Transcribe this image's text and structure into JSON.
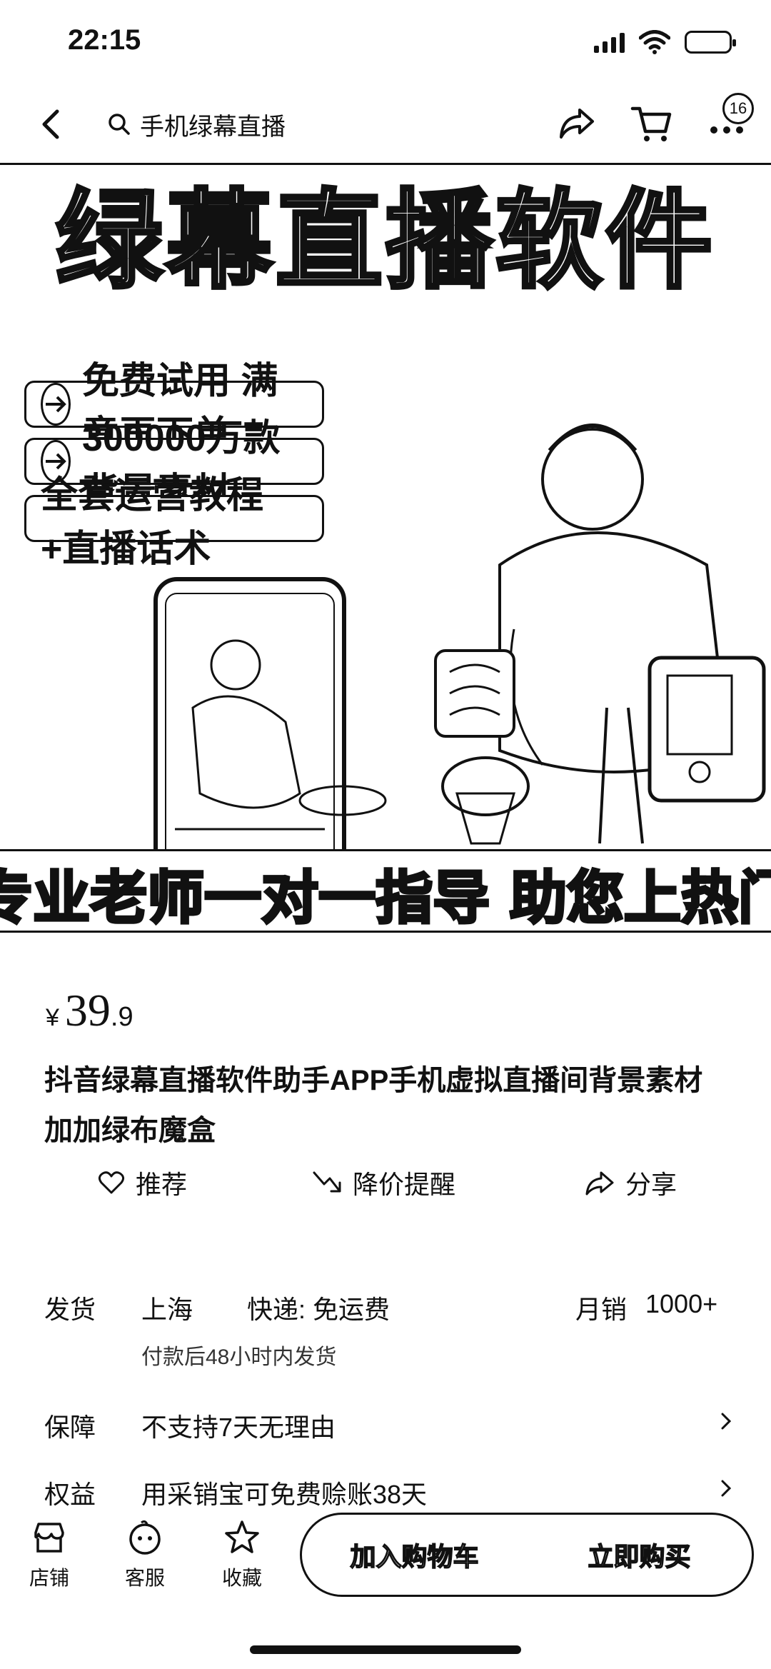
{
  "status_bar": {
    "time": "22:15"
  },
  "nav": {
    "search_text": "手机绿幕直播",
    "more_badge": "16"
  },
  "hero": {
    "title": "绿幕直播软件",
    "pills": [
      "免费试用 满意再下单",
      "300000万款背景素材",
      "全套运营教程+直播话术"
    ],
    "bottom_text": "专业老师一对一指导 助您上热门"
  },
  "product": {
    "currency": "¥",
    "price_int": "39",
    "price_dec": ".9",
    "title": "抖音绿幕直播软件助手APP手机虚拟直播间背景素材加加绿布魔盒"
  },
  "actions": {
    "recommend": "推荐",
    "price_alert": "降价提醒",
    "share": "分享"
  },
  "details": {
    "shipping_label": "发货",
    "shipping_from": "上海",
    "express": "快递: 免运费",
    "monthly_sales_label": "月销",
    "monthly_sales": "1000+",
    "shipping_note": "付款后48小时内发货",
    "guarantee_label": "保障",
    "guarantee_value": "不支持7天无理由",
    "benefit_label": "权益",
    "benefit_value": "用采销宝可免费赊账38天"
  },
  "bottom_bar": {
    "store": "店铺",
    "service": "客服",
    "favorite": "收藏",
    "add_to_cart": "加入购物车",
    "buy_now": "立即购买"
  }
}
